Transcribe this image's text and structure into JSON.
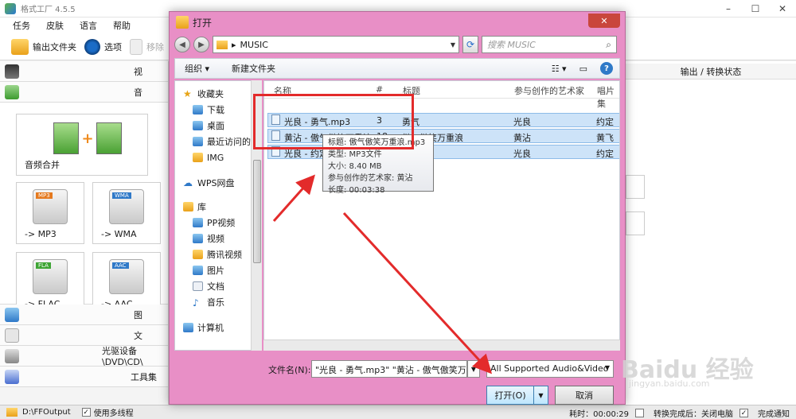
{
  "app": {
    "title": "格式工厂 4.5.5",
    "menu": [
      "任务",
      "皮肤",
      "语言",
      "帮助"
    ],
    "toolbar": {
      "output_folder": "输出文件夹",
      "options": "选项",
      "remove": "移除"
    },
    "categories": {
      "video": "视",
      "audio": "音",
      "image": "图",
      "document": "文",
      "disc": "光驱设备\\DVD\\CD\\",
      "tools": "工具集"
    },
    "audio_tiles": {
      "merge": "音频合并",
      "mp3": "-> MP3",
      "wma": "-> WMA",
      "flac": "-> FLAC",
      "aac": "-> AAC",
      "mp3_badge": "MP3",
      "wma_badge": "WMA",
      "flac_badge": "FLA",
      "aac_badge": "AAC"
    },
    "output_status_header": "输出 / 转换状态",
    "hidden_labels": {
      "output": "输出",
      "audio": "音频"
    },
    "statusbar": {
      "path": "D:\\FFOutput",
      "multithread": "使用多线程",
      "elapsed": "耗时：00:00:29",
      "after": "转换完成后：关闭电脑",
      "notify": "完成通知"
    }
  },
  "dialog": {
    "title": "打开",
    "close": "✕",
    "address": "MUSIC",
    "search_placeholder": "搜索 MUSIC",
    "organize": "组织 ▾",
    "new_folder": "新建文件夹",
    "nav": {
      "favorites": "收藏夹",
      "downloads": "下载",
      "desktop": "桌面",
      "recent": "最近访问的",
      "img": "IMG",
      "wps": "WPS网盘",
      "libraries": "库",
      "pp": "PP视频",
      "video": "视频",
      "tencent": "腾讯视频",
      "pictures": "图片",
      "documents": "文档",
      "music": "音乐",
      "computer": "计算机"
    },
    "columns": {
      "name": "名称",
      "num": "#",
      "title": "标题",
      "artists": "参与创作的艺术家",
      "album": "唱片集"
    },
    "files": [
      {
        "name": "光良 - 勇气.mp3",
        "num": "3",
        "title": "勇气",
        "artist": "光良",
        "album": "约定"
      },
      {
        "name": "黄沾 - 傲气傲笑万重浪.mp3",
        "num": "18",
        "title": "傲气傲笑万重浪",
        "artist": "黄沾",
        "album": "黄飞鸿"
      },
      {
        "name": "光良 - 约定.mp3",
        "num": "",
        "title": "",
        "artist": "光良",
        "album": "约定"
      }
    ],
    "tooltip": {
      "line1": "标题: 傲气傲笑万重浪.mp3",
      "line2": "类型: MP3文件",
      "line3": "大小: 8.40 MB",
      "line4": "参与创作的艺术家: 黄沾",
      "line5": "长度: 00:03:38"
    },
    "filename_label": "文件名(N):",
    "filename_value": "\"光良 - 勇气.mp3\" \"黄沾 - 傲气傲笑万重浪.mp3\"",
    "filter_value": "All Supported Audio&Video",
    "open_label": "打开(O)",
    "cancel_label": "取消"
  },
  "watermark": {
    "brand": "Baidu 经验",
    "url": "jingyan.baidu.com"
  },
  "colors": {
    "dialog_frame": "#e88fc6",
    "selection": "#cde3f8",
    "annotation": "#e32b2b"
  }
}
